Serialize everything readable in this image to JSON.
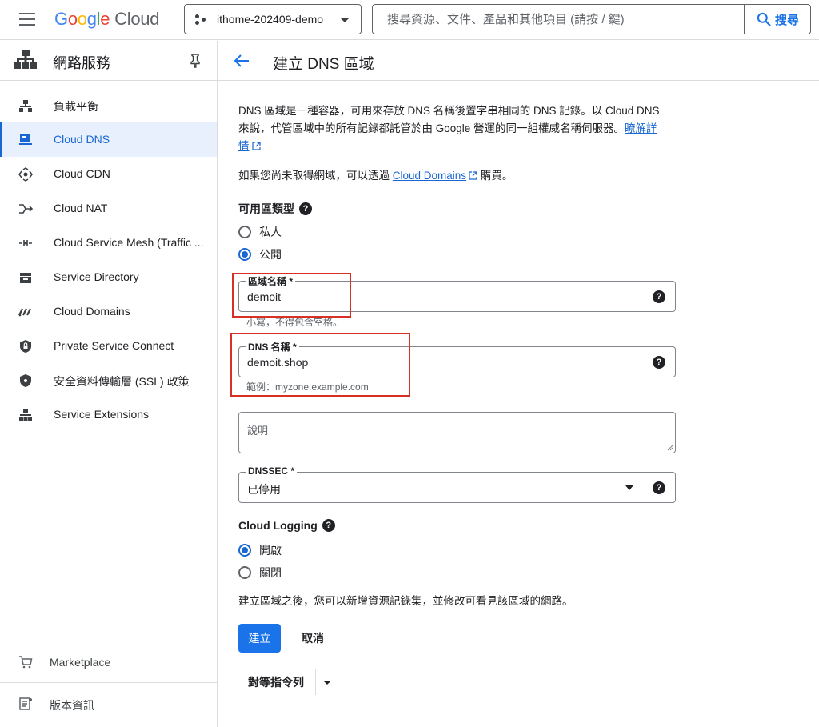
{
  "header": {
    "logo": {
      "google": "Google",
      "cloud": "Cloud"
    },
    "project": "ithome-202409-demo",
    "search_placeholder": "搜尋資源、文件、產品和其他項目 (請按 / 鍵)",
    "search_button": "搜尋"
  },
  "sidebar": {
    "title": "網路服務",
    "items": [
      {
        "label": "負載平衡",
        "icon": "load-balancing-icon"
      },
      {
        "label": "Cloud DNS",
        "icon": "dns-icon",
        "active": true
      },
      {
        "label": "Cloud CDN",
        "icon": "cdn-icon"
      },
      {
        "label": "Cloud NAT",
        "icon": "nat-icon"
      },
      {
        "label": "Cloud Service Mesh (Traffic ...",
        "icon": "service-mesh-icon"
      },
      {
        "label": "Service Directory",
        "icon": "service-directory-icon"
      },
      {
        "label": "Cloud Domains",
        "icon": "domains-icon"
      },
      {
        "label": "Private Service Connect",
        "icon": "private-service-connect-icon"
      },
      {
        "label": "安全資料傳輸層 (SSL) 政策",
        "icon": "ssl-policy-icon"
      },
      {
        "label": "Service Extensions",
        "icon": "service-extensions-icon"
      }
    ],
    "bottom": [
      {
        "label": "Marketplace",
        "icon": "marketplace-cart-icon"
      },
      {
        "label": "版本資訊",
        "icon": "release-notes-icon"
      }
    ]
  },
  "page": {
    "title": "建立 DNS 區域",
    "intro_line1": "DNS 區域是一種容器，可用來存放 DNS 名稱後置字串相同的 DNS 記錄。以 Cloud DNS",
    "intro_line2": "來說，代管區域中的所有記錄都託管於由 Google 營運的同一組權威名稱伺服器。",
    "learn_more_a": "瞭解詳",
    "learn_more_b": "情",
    "domains_prefix": "如果您尚未取得網域，可以透過 ",
    "domains_link": "Cloud Domains",
    "domains_suffix": " 購買。",
    "zone_type_label": "可用區類型",
    "zone_type_options": [
      "私人",
      "公開"
    ],
    "zone_type_selected": "公開",
    "zone_name_label": "區域名稱 *",
    "zone_name_value": "demoit",
    "zone_name_hint": "小寫，不得包含空格。",
    "dns_name_label": "DNS 名稱 *",
    "dns_name_value": "demoit.shop",
    "dns_name_hint": "範例：myzone.example.com",
    "description_placeholder": "說明",
    "dnssec_label": "DNSSEC *",
    "dnssec_value": "已停用",
    "logging_label": "Cloud Logging",
    "logging_options": [
      "開啟",
      "關閉"
    ],
    "logging_selected": "開啟",
    "footer_note": "建立區域之後，您可以新增資源記錄集，並修改可看見該區域的網路。",
    "create_button": "建立",
    "cancel_button": "取消",
    "equivalent_command": "對等指令列"
  }
}
